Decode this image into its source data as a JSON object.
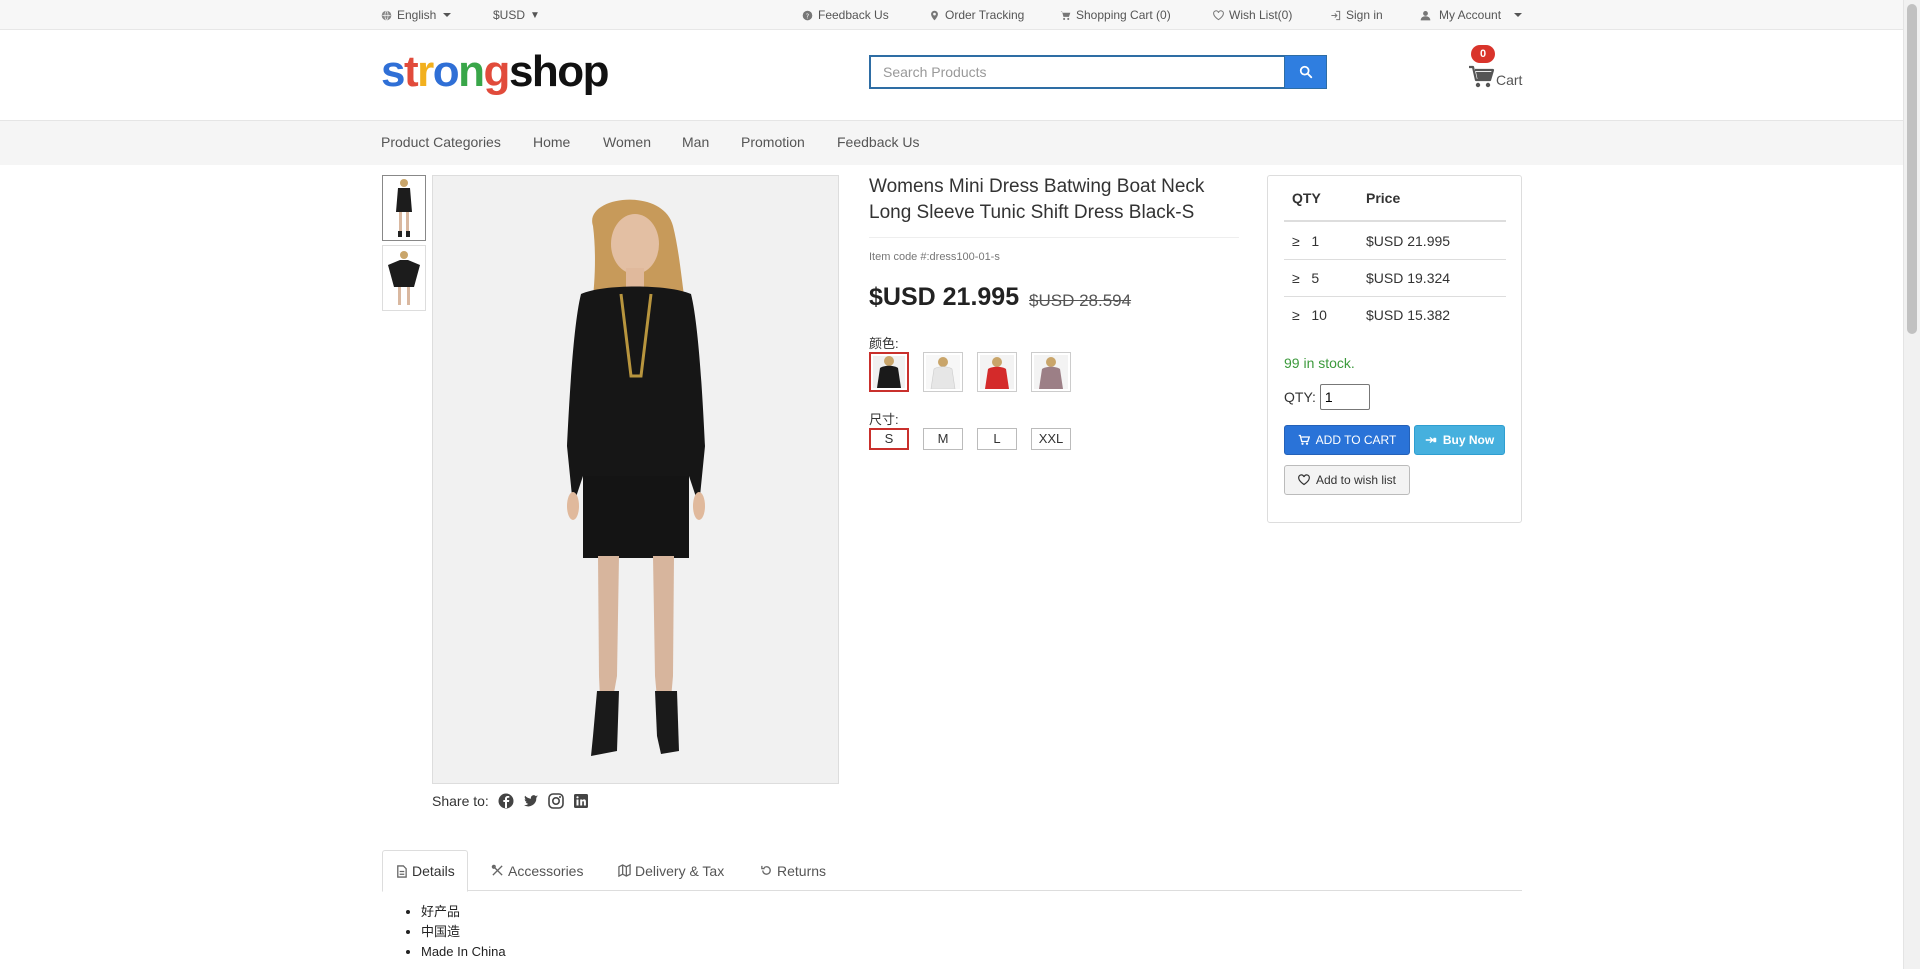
{
  "topbar": {
    "language": "English",
    "currency": "$USD",
    "feedback": "Feedback Us",
    "order_tracking": "Order Tracking",
    "shopping_cart": "Shopping Cart (0)",
    "wish_list": "Wish List(0)",
    "sign_in": "Sign in",
    "my_account": "My Account"
  },
  "header": {
    "logo_letters": [
      {
        "ch": "s",
        "color": "#2f6fd6"
      },
      {
        "ch": "t",
        "color": "#e14b3b"
      },
      {
        "ch": "r",
        "color": "#f2b01e"
      },
      {
        "ch": "o",
        "color": "#2f6fd6"
      },
      {
        "ch": "n",
        "color": "#39a649"
      },
      {
        "ch": "g",
        "color": "#e14b3b"
      },
      {
        "ch": "shop",
        "color": "#111111"
      }
    ],
    "search_placeholder": "Search Products",
    "cart_count": "0",
    "cart_label": "Cart"
  },
  "nav": {
    "items": [
      "Product Categories",
      "Home",
      "Women",
      "Man",
      "Promotion",
      "Feedback Us"
    ]
  },
  "product": {
    "title": "Womens Mini Dress Batwing Boat Neck Long Sleeve Tunic Shift Dress Black-S",
    "item_code": "Item code #:dress100-01-s",
    "price": "$USD 21.995",
    "old_price": "$USD 28.594",
    "color_label": "颜色:",
    "colors": [
      {
        "name": "black",
        "hex": "#1a1a1a",
        "selected": true
      },
      {
        "name": "white",
        "hex": "#e8e8e8",
        "selected": false
      },
      {
        "name": "red",
        "hex": "#d42a2a",
        "selected": false
      },
      {
        "name": "mauve",
        "hex": "#9c7f86",
        "selected": false
      }
    ],
    "size_label": "尺寸:",
    "sizes": [
      "S",
      "M",
      "L",
      "XXL"
    ],
    "selected_size": "S",
    "share_label": "Share to:"
  },
  "buybox": {
    "qty_header": "QTY",
    "price_header": "Price",
    "tiers": [
      {
        "qty": "≥   1",
        "price": "$USD 21.995"
      },
      {
        "qty": "≥   5",
        "price": "$USD 19.324"
      },
      {
        "qty": "≥   10",
        "price": "$USD 15.382"
      }
    ],
    "stock": "99 in stock.",
    "qty_label": "QTY:",
    "qty_value": "1",
    "add_to_cart": "ADD TO CART",
    "buy_now": "Buy Now",
    "add_to_wishlist": "Add to wish list"
  },
  "tabs": {
    "items": [
      "Details",
      "Accessories",
      "Delivery & Tax",
      "Returns"
    ],
    "active": "Details"
  },
  "details": {
    "bullets": [
      "好产品",
      "中国造",
      "Made In China"
    ]
  },
  "colors": {
    "primary": "#2a73d8",
    "info": "#46b0de",
    "danger": "#c9302c",
    "success": "#3c9a3c"
  }
}
